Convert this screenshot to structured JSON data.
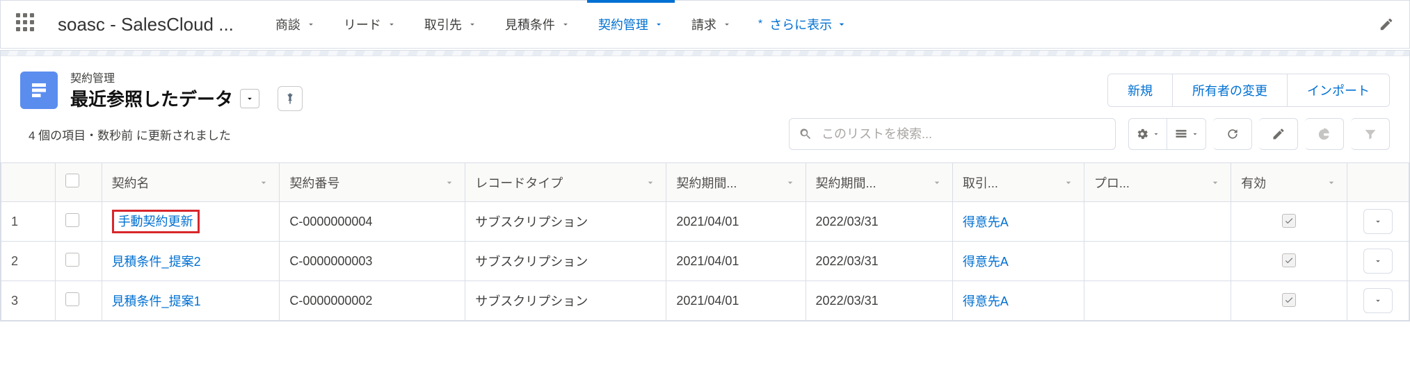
{
  "app": {
    "name": "soasc - SalesCloud ..."
  },
  "nav": {
    "tabs": [
      {
        "label": "商談"
      },
      {
        "label": "リード"
      },
      {
        "label": "取引先"
      },
      {
        "label": "見積条件"
      },
      {
        "label": "契約管理",
        "active": true
      },
      {
        "label": "請求"
      }
    ],
    "more_label": "さらに表示"
  },
  "list": {
    "object_label": "契約管理",
    "view_name": "最近参照したデータ",
    "status": "4 個の項目・数秒前 に更新されました",
    "search_placeholder": "このリストを検索...",
    "actions": {
      "new": "新規",
      "change_owner": "所有者の変更",
      "import": "インポート"
    },
    "columns": {
      "name": "契約名",
      "number": "契約番号",
      "record_type": "レコードタイプ",
      "period_from": "契約期間...",
      "period_to": "契約期間...",
      "account": "取引...",
      "process": "プロ...",
      "valid": "有効"
    },
    "rows": [
      {
        "n": "1",
        "name": "手動契約更新",
        "highlight": true,
        "number": "C-0000000004",
        "record_type": "サブスクリプション",
        "from": "2021/04/01",
        "to": "2022/03/31",
        "account": "得意先A",
        "process": "",
        "valid": true
      },
      {
        "n": "2",
        "name": "見積条件_提案2",
        "number": "C-0000000003",
        "record_type": "サブスクリプション",
        "from": "2021/04/01",
        "to": "2022/03/31",
        "account": "得意先A",
        "process": "",
        "valid": true
      },
      {
        "n": "3",
        "name": "見積条件_提案1",
        "number": "C-0000000002",
        "record_type": "サブスクリプション",
        "from": "2021/04/01",
        "to": "2022/03/31",
        "account": "得意先A",
        "process": "",
        "valid": true
      }
    ]
  }
}
